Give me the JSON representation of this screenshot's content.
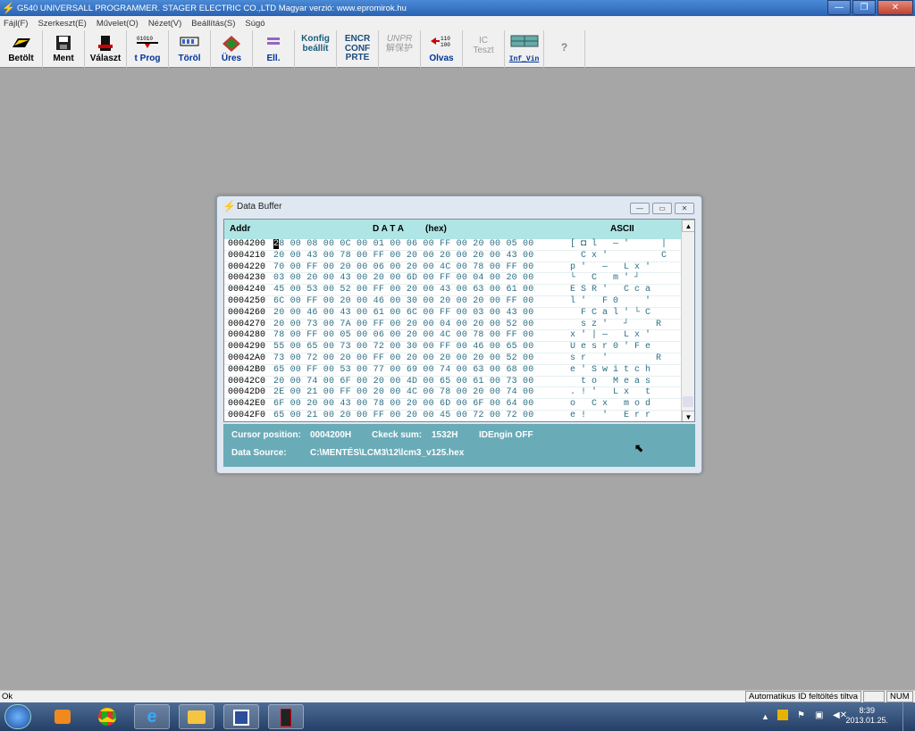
{
  "window": {
    "title": "G540 UNIVERSALL PROGRAMMER.  STAGER ELECTRIC CO.,LTD  Magyar verzió: www.epromirok.hu"
  },
  "menu": [
    "Fájl(F)",
    "Szerkeszt(E)",
    "Művelet(O)",
    "Nézet(V)",
    "Beállítás(S)",
    "Súgó"
  ],
  "toolbar": {
    "load": "Betölt",
    "save": "Ment",
    "select": "Választ",
    "prog": "t Prog",
    "erase": "Töröl",
    "blank": "Üres",
    "verify": "Ell.",
    "config1": "Konfig",
    "config2": "beállít",
    "encr1": "ENCR",
    "encr2": "CONF",
    "encr3": "PRTE",
    "unpr1": "UNPR",
    "unpr2": "解保护",
    "read": "Olvas",
    "ic1": "IC",
    "ic2": "Teszt",
    "info": "Inf_Vin",
    "help": "?"
  },
  "databuffer": {
    "title": "Data Buffer",
    "col_addr": "Addr",
    "col_data": "D A T A",
    "col_hex": "(hex)",
    "col_ascii": "ASCII",
    "rows": [
      {
        "addr": "0004200",
        "hex": "28 00 08 00 0C 00 01 00 06 00 FF 00 20 00 05 00",
        "ascii": "[ ◘ l   — '      |"
      },
      {
        "addr": "0004210",
        "hex": "20 00 43 00 78 00 FF 00 20 00 20 00 20 00 43 00",
        "ascii": "  C x '          C"
      },
      {
        "addr": "0004220",
        "hex": "70 00 FF 00 20 00 06 00 20 00 4C 00 78 00 FF 00",
        "ascii": "p '   —   L x '"
      },
      {
        "addr": "0004230",
        "hex": "03 00 20 00 43 00 20 00 6D 00 FF 00 04 00 20 00",
        "ascii": "└   C   m ' ┘"
      },
      {
        "addr": "0004240",
        "hex": "45 00 53 00 52 00 FF 00 20 00 43 00 63 00 61 00",
        "ascii": "E S R '   C c a"
      },
      {
        "addr": "0004250",
        "hex": "6C 00 FF 00 20 00 46 00 30 00 20 00 20 00 FF 00",
        "ascii": "l '   F 0     '"
      },
      {
        "addr": "0004260",
        "hex": "20 00 46 00 43 00 61 00 6C 00 FF 00 03 00 43 00",
        "ascii": "  F C a l ' └ C"
      },
      {
        "addr": "0004270",
        "hex": "20 00 73 00 7A 00 FF 00 20 00 04 00 20 00 52 00",
        "ascii": "  s z '   ┘     R"
      },
      {
        "addr": "0004280",
        "hex": "78 00 FF 00 05 00 06 00 20 00 4C 00 78 00 FF 00",
        "ascii": "x ' | —   L x '"
      },
      {
        "addr": "0004290",
        "hex": "55 00 65 00 73 00 72 00 30 00 FF 00 46 00 65 00",
        "ascii": "U e s r 0 ' F e"
      },
      {
        "addr": "00042A0",
        "hex": "73 00 72 00 20 00 FF 00 20 00 20 00 20 00 52 00",
        "ascii": "s r   '         R"
      },
      {
        "addr": "00042B0",
        "hex": "65 00 FF 00 53 00 77 00 69 00 74 00 63 00 68 00",
        "ascii": "e ' S w i t c h"
      },
      {
        "addr": "00042C0",
        "hex": "20 00 74 00 6F 00 20 00 4D 00 65 00 61 00 73 00",
        "ascii": "  t o   M e a s"
      },
      {
        "addr": "00042D0",
        "hex": "2E 00 21 00 FF 00 20 00 4C 00 78 00 20 00 74 00",
        "ascii": ". ! '   L x   t"
      },
      {
        "addr": "00042E0",
        "hex": "6F 00 20 00 43 00 78 00 20 00 6D 00 6F 00 64 00",
        "ascii": "o   C x   m o d"
      },
      {
        "addr": "00042F0",
        "hex": "65 00 21 00 20 00 FF 00 20 00 45 00 72 00 72 00",
        "ascii": "e !   '   E r r"
      }
    ],
    "cursor_label": "Cursor position:",
    "cursor_value": "0004200H",
    "checksum_label": "Ckeck sum:",
    "checksum_value": "1532H",
    "idengin": "IDEngin OFF",
    "source_label": "Data Source:",
    "source_value": "C:\\MENTÉS\\LCM3\\12\\lcm3_v125.hex"
  },
  "status": {
    "left": "Ok",
    "auto_id": "Automatikus ID feltöltés tiltva",
    "num": "NUM"
  },
  "clock": {
    "time": "8:39",
    "date": "2013.01.25."
  }
}
